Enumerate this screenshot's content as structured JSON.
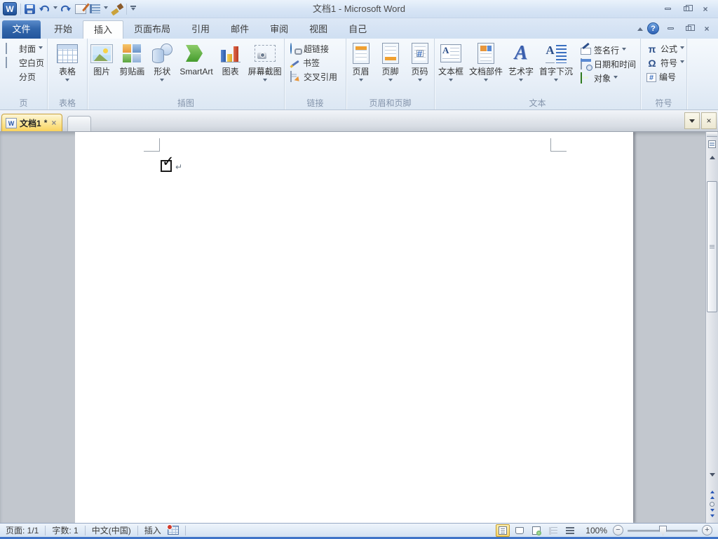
{
  "window": {
    "title": "文档1 - Microsoft Word"
  },
  "glyphs": {
    "word_logo": "W",
    "help": "?",
    "close": "×",
    "check": "✓",
    "pilcrow": "↵",
    "minus": "−",
    "plus": "+"
  },
  "tab_row": {
    "file": "文件",
    "active_tab": "插入",
    "tabs": [
      {
        "label": "开始"
      },
      {
        "label": "插入"
      },
      {
        "label": "页面布局"
      },
      {
        "label": "引用"
      },
      {
        "label": "邮件"
      },
      {
        "label": "审阅"
      },
      {
        "label": "视图"
      },
      {
        "label": "自己"
      }
    ]
  },
  "ribbon": {
    "groups": [
      {
        "label": "页",
        "buttons": [
          {
            "label": "封面",
            "dropdown": true
          },
          {
            "label": "空白页",
            "dropdown": false
          },
          {
            "label": "分页",
            "dropdown": false
          }
        ]
      },
      {
        "label": "表格",
        "buttons": [
          {
            "label": "表格",
            "dropdown": true
          }
        ]
      },
      {
        "label": "插图",
        "buttons": [
          {
            "label": "图片",
            "dropdown": false
          },
          {
            "label": "剪贴画",
            "dropdown": false
          },
          {
            "label": "形状",
            "dropdown": true
          },
          {
            "label": "SmartArt",
            "dropdown": false
          },
          {
            "label": "图表",
            "dropdown": false
          },
          {
            "label": "屏幕截图",
            "dropdown": true
          }
        ]
      },
      {
        "label": "链接",
        "buttons": [
          {
            "label": "超链接",
            "dropdown": false
          },
          {
            "label": "书签",
            "dropdown": false
          },
          {
            "label": "交叉引用",
            "dropdown": false
          }
        ]
      },
      {
        "label": "页眉和页脚",
        "buttons": [
          {
            "label": "页眉",
            "dropdown": true
          },
          {
            "label": "页脚",
            "dropdown": true
          },
          {
            "label": "页码",
            "dropdown": true
          }
        ]
      },
      {
        "label": "文本",
        "buttons": [
          {
            "label": "文本框",
            "dropdown": true
          },
          {
            "label": "文档部件",
            "dropdown": true
          },
          {
            "label": "艺术字",
            "dropdown": true
          },
          {
            "label": "首字下沉",
            "dropdown": true
          }
        ],
        "small_buttons": [
          {
            "label": "签名行",
            "dropdown": true
          },
          {
            "label": "日期和时间",
            "dropdown": false
          },
          {
            "label": "对象",
            "dropdown": true
          }
        ]
      },
      {
        "label": "符号",
        "buttons": [
          {
            "label": "公式",
            "glyph": "π",
            "dropdown": true
          },
          {
            "label": "符号",
            "glyph": "Ω",
            "dropdown": true
          },
          {
            "label": "编号",
            "glyph": "#",
            "dropdown": false
          }
        ]
      }
    ]
  },
  "doc_tabs": {
    "active": {
      "label": "文档1",
      "modified": "*"
    }
  },
  "status_bar": {
    "page": "页面: 1/1",
    "word_count": "字数: 1",
    "language": "中文(中国)",
    "insert_mode": "插入",
    "zoom_level": "100%"
  }
}
